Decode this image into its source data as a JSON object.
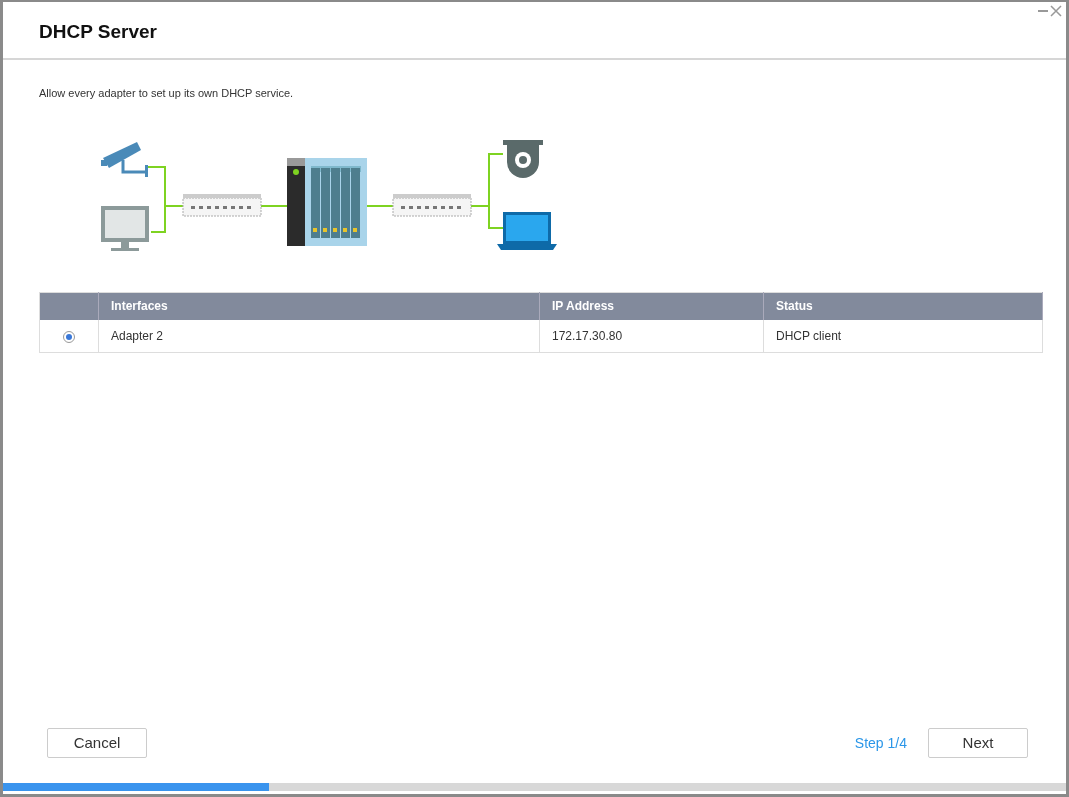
{
  "window": {
    "title": "DHCP Server"
  },
  "description": "Allow every adapter to set up its own DHCP service.",
  "table": {
    "columns": [
      "Interfaces",
      "IP Address",
      "Status"
    ],
    "rows": [
      {
        "selected": true,
        "cells": [
          "Adapter 2",
          "172.17.30.80",
          "DHCP client"
        ]
      }
    ]
  },
  "footer": {
    "cancel": "Cancel",
    "step": "Step 1/4",
    "next": "Next"
  },
  "progress": {
    "level": 0.25
  }
}
